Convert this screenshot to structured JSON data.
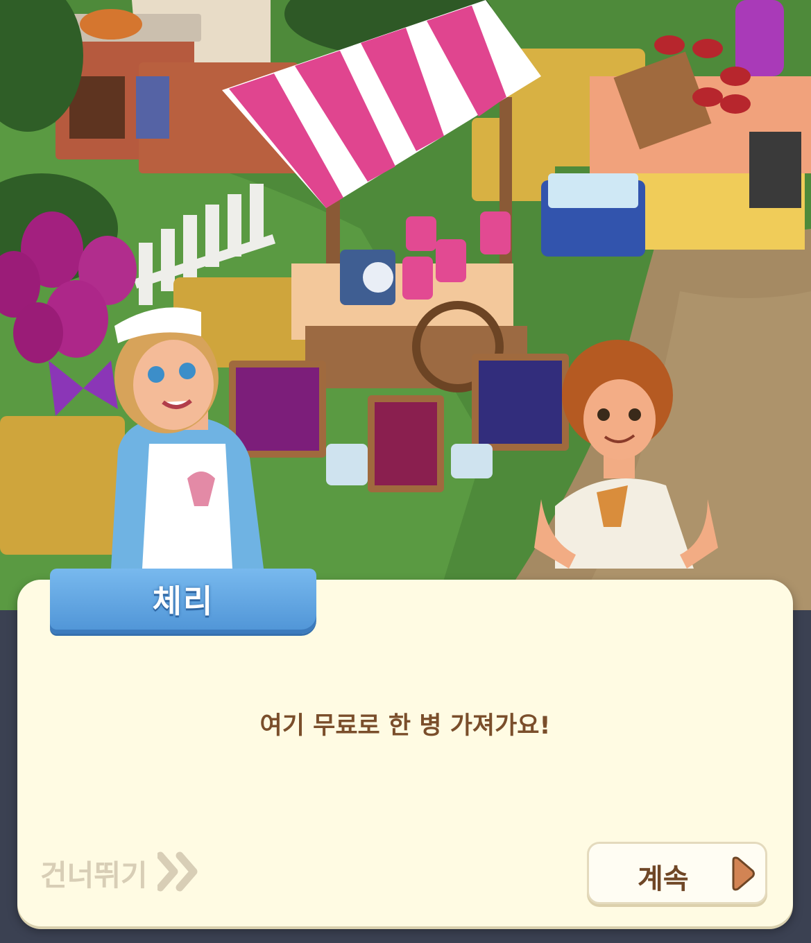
{
  "dialog": {
    "speaker": "체리",
    "text": "여기 무료로 한 병 가져가요!"
  },
  "controls": {
    "skip_label": "건너뛰기",
    "skip_icon": "double-chevron-right-icon",
    "continue_label": "계속",
    "continue_icon": "play-triangle-icon"
  },
  "colors": {
    "dialog_bg": "#fffbe3",
    "name_tab": "#5a9fe0",
    "dialog_text": "#7a4e2b",
    "awning_stripe": "#e0458f"
  }
}
